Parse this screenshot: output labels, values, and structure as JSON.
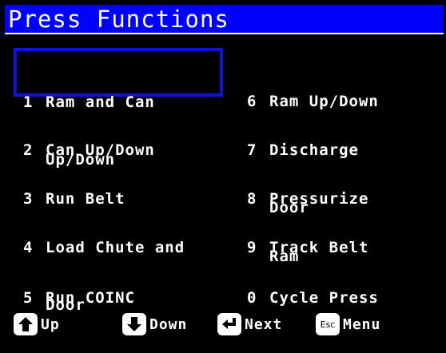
{
  "title": "Press Functions",
  "menu": {
    "item1": {
      "num": "1",
      "line1": "Ram and Can",
      "line2": "Up/Down"
    },
    "item2": {
      "num": "2",
      "line1": "Can Up/Down"
    },
    "item3": {
      "num": "3",
      "line1": "Run Belt"
    },
    "item4": {
      "num": "4",
      "line1": "Load Chute and",
      "line2": "Door"
    },
    "item5": {
      "num": "5",
      "line1": "Run COINC"
    },
    "item6": {
      "num": "6",
      "line1": "Ram Up/Down"
    },
    "item7": {
      "num": "7",
      "line1": "Discharge",
      "line2": "Door"
    },
    "item8": {
      "num": "8",
      "line1": "Pressurize",
      "line2": "Ram"
    },
    "item9": {
      "num": "9",
      "line1": "Track Belt"
    },
    "item0": {
      "num": "0",
      "line1": "Cycle Press"
    }
  },
  "selected_item": "1",
  "footer": {
    "up": {
      "icon": "arrow-up-icon",
      "label": "Up"
    },
    "down": {
      "icon": "arrow-down-icon",
      "label": "Down"
    },
    "next": {
      "icon": "enter-icon",
      "label": "Next"
    },
    "menu": {
      "icon": "esc-key-icon",
      "icon_text": "Esc",
      "label": "Menu"
    }
  },
  "colors": {
    "title_bar": "#0000ff",
    "selection": "#1010e0",
    "background": "#000000",
    "text": "#ffffff"
  }
}
